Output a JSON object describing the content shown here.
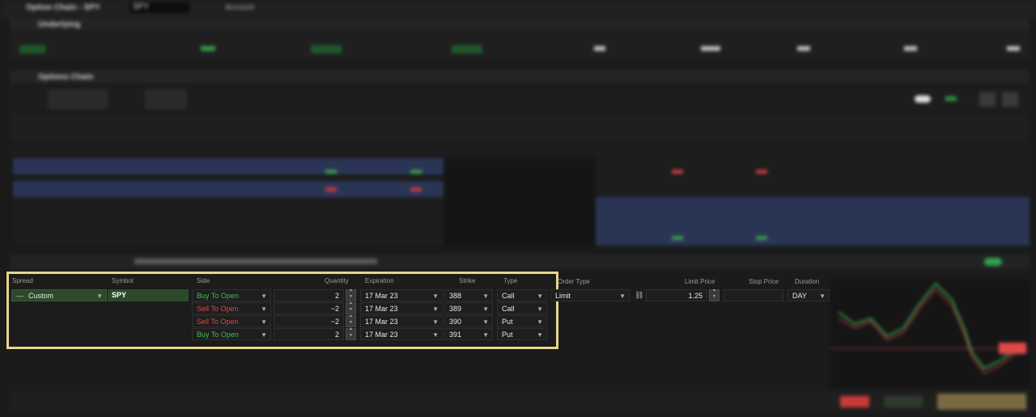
{
  "window": {
    "title": "Option Chain - SPY",
    "symbol": "SPY",
    "account": "Account"
  },
  "sections": {
    "underlying": "Underlying",
    "option_chain": "Options Chain"
  },
  "order_entry": {
    "headers": {
      "spread": "Spread",
      "symbol": "Symbol",
      "side": "Side",
      "quantity": "Quantity",
      "expiration": "Expiration",
      "strike": "Strike",
      "type": "Type",
      "order_type": "Order Type",
      "limit_price": "Limit Price",
      "stop_price": "Stop Price",
      "duration": "Duration"
    },
    "spread": "Custom",
    "symbol": "SPY",
    "order_type": "Limit",
    "limit_price": "1.25",
    "stop_price": "",
    "duration": "DAY",
    "legs": [
      {
        "side": "Buy To Open",
        "quantity": "2",
        "expiration": "17 Mar 23",
        "strike": "388",
        "type": "Call"
      },
      {
        "side": "Sell To Open",
        "quantity": "−2",
        "expiration": "17 Mar 23",
        "strike": "389",
        "type": "Call"
      },
      {
        "side": "Sell To Open",
        "quantity": "−2",
        "expiration": "17 Mar 23",
        "strike": "390",
        "type": "Put"
      },
      {
        "side": "Buy To Open",
        "quantity": "2",
        "expiration": "17 Mar 23",
        "strike": "391",
        "type": "Put"
      }
    ]
  },
  "colors": {
    "highlight_border": "#e7d68a",
    "buy": "#3fbf57",
    "sell": "#e04848",
    "chain_band": "#2a3556"
  }
}
